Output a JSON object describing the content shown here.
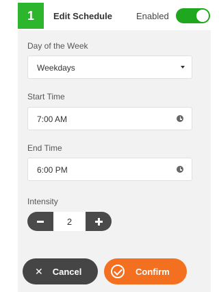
{
  "header": {
    "step_number": "1",
    "title": "Edit Schedule",
    "enabled_label": "Enabled",
    "enabled": true
  },
  "day_of_week": {
    "label": "Day of the Week",
    "value": "Weekdays"
  },
  "start_time": {
    "label": "Start Time",
    "value": "7:00 AM"
  },
  "end_time": {
    "label": "End Time",
    "value": "6:00 PM"
  },
  "intensity": {
    "label": "Intensity",
    "value": "2"
  },
  "actions": {
    "cancel_label": "Cancel",
    "confirm_label": "Confirm"
  },
  "colors": {
    "accent_green": "#2db52d",
    "confirm_orange": "#f37021",
    "dark_gray": "#454545"
  }
}
